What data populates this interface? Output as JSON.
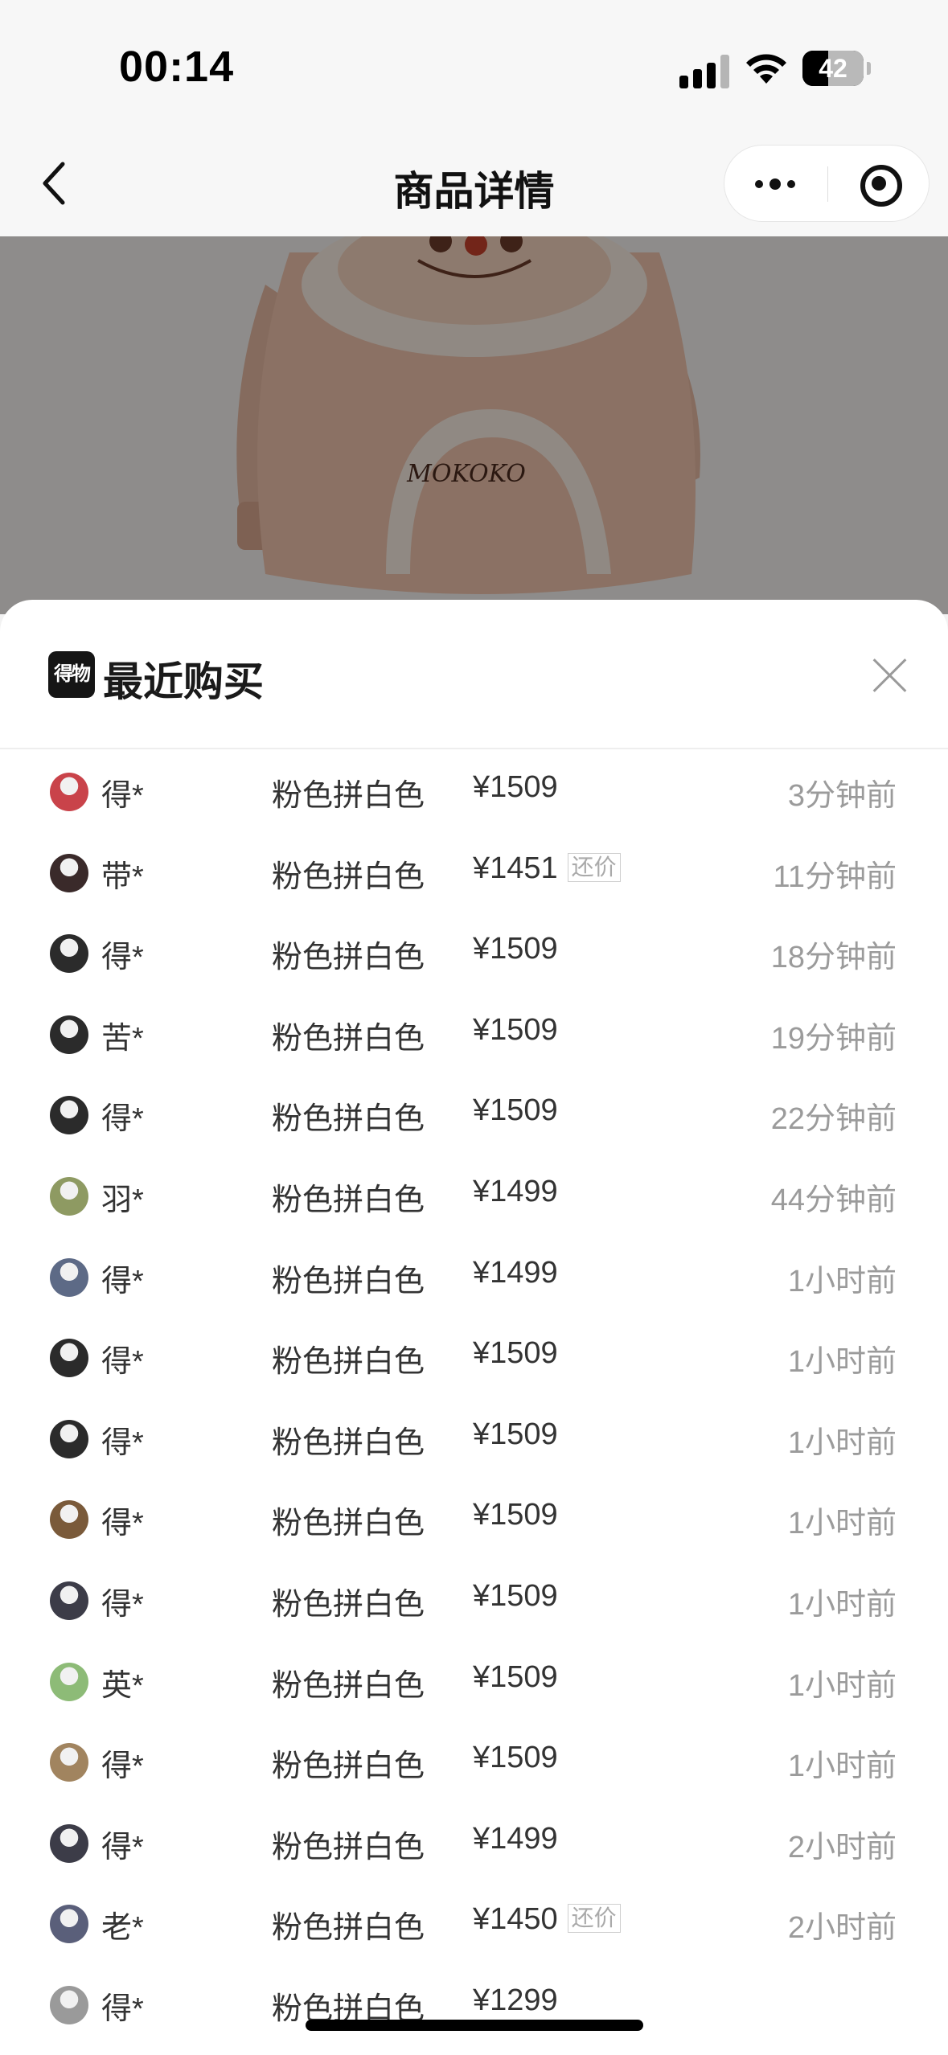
{
  "status_bar": {
    "time": "00:14",
    "battery": "42",
    "battery_level": 0.42
  },
  "nav": {
    "title": "商品详情"
  },
  "product": {
    "brand_text": "MOKOKO"
  },
  "sheet": {
    "logo_text": "得物",
    "title": "最近购买",
    "rows": [
      {
        "user": "得*",
        "variant": "粉色拼白色",
        "price": "¥1509",
        "tag": "",
        "time": "3分钟前",
        "avatar_color": "#c9434a"
      },
      {
        "user": "带*",
        "variant": "粉色拼白色",
        "price": "¥1451",
        "tag": "还价",
        "time": "11分钟前",
        "avatar_color": "#3a2a2a"
      },
      {
        "user": "得*",
        "variant": "粉色拼白色",
        "price": "¥1509",
        "tag": "",
        "time": "18分钟前",
        "avatar_color": "#2b2b2b"
      },
      {
        "user": "苦*",
        "variant": "粉色拼白色",
        "price": "¥1509",
        "tag": "",
        "time": "19分钟前",
        "avatar_color": "#2b2b2b"
      },
      {
        "user": "得*",
        "variant": "粉色拼白色",
        "price": "¥1509",
        "tag": "",
        "time": "22分钟前",
        "avatar_color": "#2b2b2b"
      },
      {
        "user": "羽*",
        "variant": "粉色拼白色",
        "price": "¥1499",
        "tag": "",
        "time": "44分钟前",
        "avatar_color": "#8e9a62"
      },
      {
        "user": "得*",
        "variant": "粉色拼白色",
        "price": "¥1499",
        "tag": "",
        "time": "1小时前",
        "avatar_color": "#5d6a86"
      },
      {
        "user": "得*",
        "variant": "粉色拼白色",
        "price": "¥1509",
        "tag": "",
        "time": "1小时前",
        "avatar_color": "#2b2b2b"
      },
      {
        "user": "得*",
        "variant": "粉色拼白色",
        "price": "¥1509",
        "tag": "",
        "time": "1小时前",
        "avatar_color": "#2b2b2b"
      },
      {
        "user": "得*",
        "variant": "粉色拼白色",
        "price": "¥1509",
        "tag": "",
        "time": "1小时前",
        "avatar_color": "#7a5a3a"
      },
      {
        "user": "得*",
        "variant": "粉色拼白色",
        "price": "¥1509",
        "tag": "",
        "time": "1小时前",
        "avatar_color": "#3c3c48"
      },
      {
        "user": "英*",
        "variant": "粉色拼白色",
        "price": "¥1509",
        "tag": "",
        "time": "1小时前",
        "avatar_color": "#8dbb77"
      },
      {
        "user": "得*",
        "variant": "粉色拼白色",
        "price": "¥1509",
        "tag": "",
        "time": "1小时前",
        "avatar_color": "#a1845f"
      },
      {
        "user": "得*",
        "variant": "粉色拼白色",
        "price": "¥1499",
        "tag": "",
        "time": "2小时前",
        "avatar_color": "#3c3c48"
      },
      {
        "user": "老*",
        "variant": "粉色拼白色",
        "price": "¥1450",
        "tag": "还价",
        "time": "2小时前",
        "avatar_color": "#5a5f7a"
      },
      {
        "user": "得*",
        "variant": "粉色拼白色",
        "price": "¥1299",
        "tag": "",
        "time": "",
        "avatar_color": "#9a9a9a"
      }
    ]
  }
}
